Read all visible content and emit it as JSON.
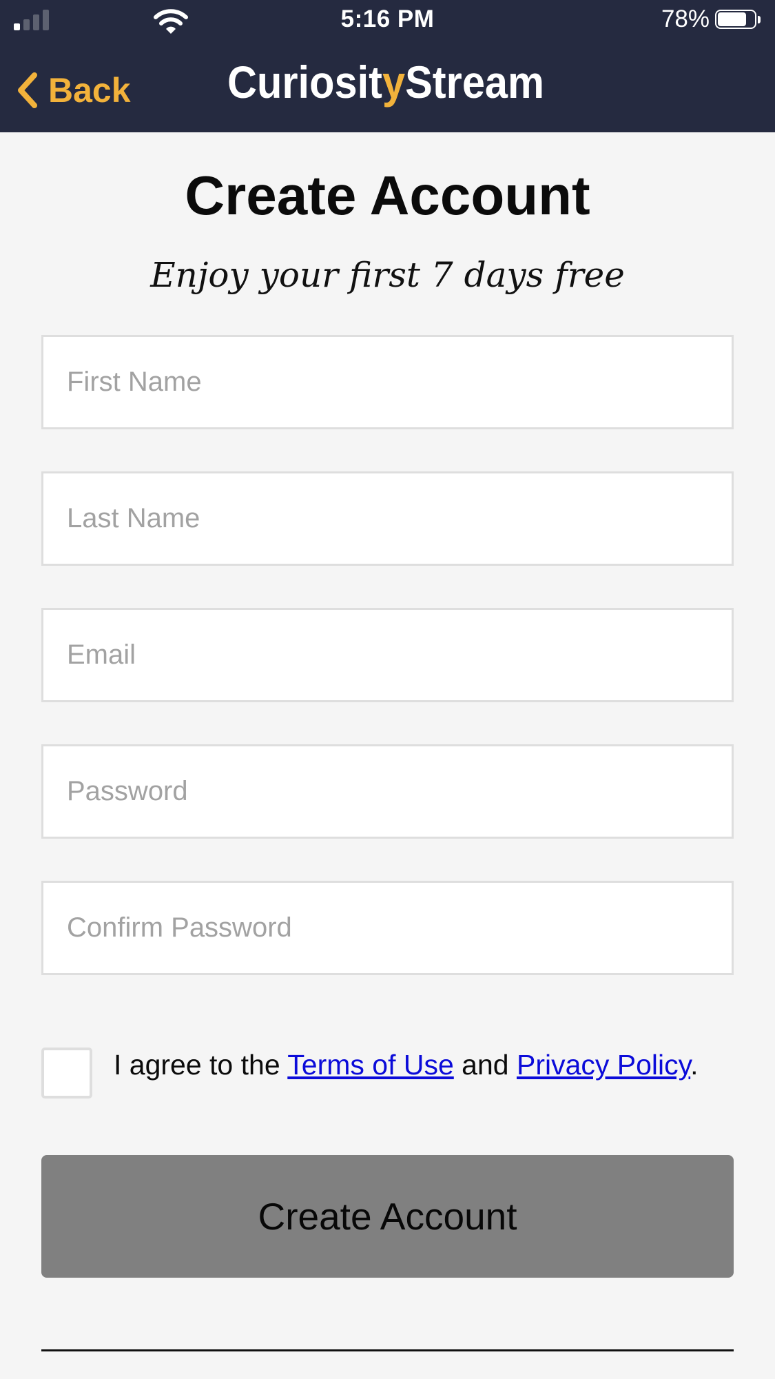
{
  "status_bar": {
    "time": "5:16 PM",
    "battery_percent": "78%",
    "battery_level": 0.78,
    "signal_bars_active": 1,
    "signal_bars_total": 4
  },
  "nav": {
    "back_label": "Back",
    "logo_text": "CuriosityStream"
  },
  "form": {
    "title": "Create Account",
    "subtitle": "Enjoy your first 7 days free",
    "fields": [
      {
        "placeholder": "First Name",
        "value": ""
      },
      {
        "placeholder": "Last Name",
        "value": ""
      },
      {
        "placeholder": "Email",
        "value": ""
      },
      {
        "placeholder": "Password",
        "value": ""
      },
      {
        "placeholder": "Confirm Password",
        "value": ""
      }
    ],
    "agreement": {
      "checked": false,
      "prefix": "I agree to the ",
      "terms_link": "Terms of Use",
      "middle": " and ",
      "privacy_link": "Privacy Policy",
      "suffix": "."
    },
    "submit_label": "Create Account"
  },
  "colors": {
    "header_bg": "#252a40",
    "accent_gold": "#f2b23b",
    "page_bg": "#f5f5f5",
    "button_bg": "#808080",
    "link_blue": "#0b0bd9"
  },
  "icons": {
    "back": "chevron-left-icon",
    "signal": "cellular-signal-icon",
    "wifi": "wifi-icon",
    "battery": "battery-icon"
  }
}
